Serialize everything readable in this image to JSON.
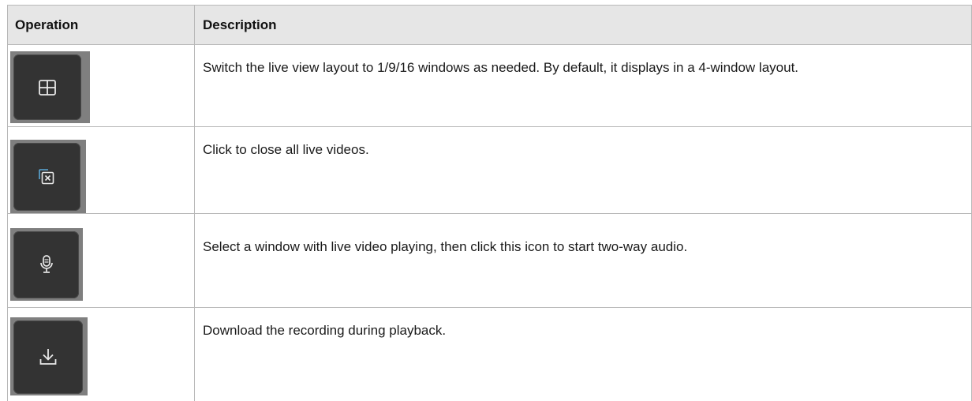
{
  "table": {
    "headers": {
      "operation": "Operation",
      "description": "Description"
    },
    "rows": [
      {
        "icon": "window-layout-grid-icon",
        "description": "Switch the live view layout to 1/9/16 windows as needed. By default, it displays in a 4-window layout."
      },
      {
        "icon": "close-all-videos-icon",
        "description": "Click to close all live videos."
      },
      {
        "icon": "microphone-icon",
        "description": "Select a window with live video playing, then click this icon to start two-way audio."
      },
      {
        "icon": "download-icon",
        "description": "Download the recording during playback."
      }
    ]
  },
  "colors": {
    "header_background": "#e6e6e6",
    "button_background": "#333333",
    "button_frame": "#7f7f7f",
    "icon_stroke": "#e8e8e8",
    "gridline": "#b8b8b8"
  }
}
